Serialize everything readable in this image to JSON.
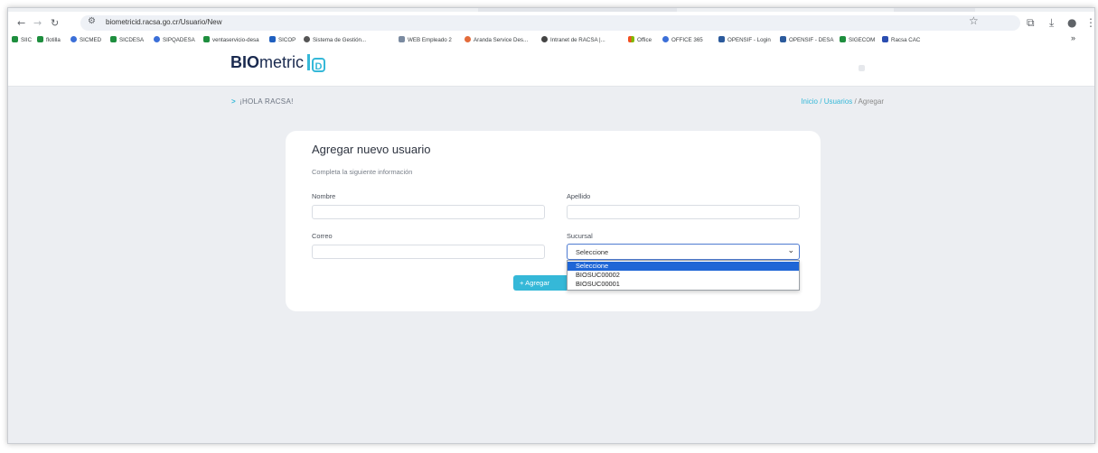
{
  "browser": {
    "url": "biometricid.racsa.go.cr/Usuario/New",
    "nav_icons": [
      "back-icon",
      "forward-icon",
      "reload-icon"
    ],
    "bookmarks": [
      {
        "label": "SIIC",
        "icon": "drive-icon",
        "color": "#1e8e3e"
      },
      {
        "label": "flotilla",
        "icon": "drive-icon",
        "color": "#1e8e3e"
      },
      {
        "label": "SICMED",
        "icon": "app-icon",
        "color": "#3b6fd8"
      },
      {
        "label": "SICDESA",
        "icon": "drive-icon",
        "color": "#1e8e3e"
      },
      {
        "label": "SIPQADESA",
        "icon": "app-icon",
        "color": "#3b6fd8"
      },
      {
        "label": "ventaservicio-desa",
        "icon": "drive-icon",
        "color": "#1e8e3e"
      },
      {
        "label": "SICOP",
        "icon": "sicop-icon",
        "color": "#1f5fbf"
      },
      {
        "label": "Sistema de Gestión...",
        "icon": "globe-icon",
        "color": "#555"
      },
      {
        "label": "WEB Empleado 2",
        "icon": "web-icon",
        "color": "#7a8aa0"
      },
      {
        "label": "Aranda Service Des...",
        "icon": "aranda-icon",
        "color": "#e36b3a"
      },
      {
        "label": "Intranet de RACSA |...",
        "icon": "globe-icon",
        "color": "#444"
      },
      {
        "label": "Office",
        "icon": "office-icon",
        "color": "#f25022"
      },
      {
        "label": "OFFICE 365",
        "icon": "app-icon",
        "color": "#3b6fd8"
      },
      {
        "label": "OPENSIF - Login",
        "icon": "card-icon",
        "color": "#2b5a9c"
      },
      {
        "label": "OPENSIF - DESA",
        "icon": "card-icon",
        "color": "#2b5a9c"
      },
      {
        "label": "SIGECOM",
        "icon": "drive-icon",
        "color": "#1e8e3e"
      },
      {
        "label": "Racsa CAC",
        "icon": "a-icon",
        "color": "#2a4db0"
      }
    ],
    "overflow_label": "»"
  },
  "app": {
    "logo_bio": "BIO",
    "logo_metric": "metric",
    "logo_d": "D",
    "greeting": "¡HOLA RACSA!",
    "breadcrumb": {
      "home": "Inicio",
      "sep1": "/",
      "users": "Usuarios",
      "sep2": "/",
      "current": "Agregar"
    },
    "accent": "#35b8d8"
  },
  "form": {
    "title": "Agregar nuevo usuario",
    "subtitle": "Completa la siguiente información",
    "nombre_label": "Nombre",
    "nombre_value": "",
    "apellido_label": "Apellido",
    "apellido_value": "",
    "correo_label": "Correo",
    "correo_value": "",
    "sucursal_label": "Sucursal",
    "sucursal_value": "Seleccione",
    "submit_label": "+ Agregar",
    "sucursal_options": [
      "Seleccione",
      "BIOSUC00002",
      "BIOSUC00001"
    ]
  }
}
